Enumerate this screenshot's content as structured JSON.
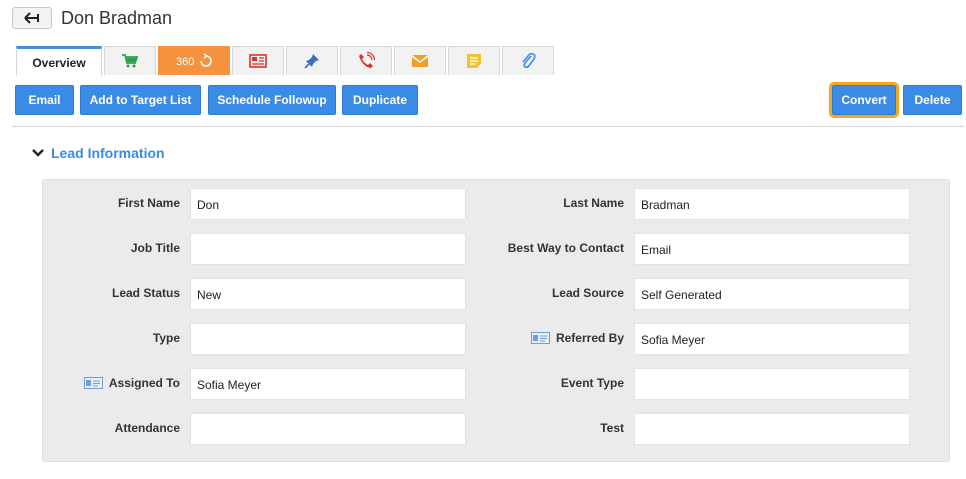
{
  "header": {
    "title": "Don Bradman"
  },
  "tabs": [
    {
      "label": "Overview",
      "icon": "overview"
    },
    {
      "label": "",
      "icon": "cart-icon"
    },
    {
      "label": "360",
      "icon": "360-icon"
    },
    {
      "label": "",
      "icon": "newspaper-icon"
    },
    {
      "label": "",
      "icon": "pin-icon"
    },
    {
      "label": "",
      "icon": "phone-icon"
    },
    {
      "label": "",
      "icon": "mail-icon"
    },
    {
      "label": "",
      "icon": "note-icon"
    },
    {
      "label": "",
      "icon": "paperclip-icon"
    }
  ],
  "actions": {
    "email": "Email",
    "add_to_target_list": "Add to Target List",
    "schedule_followup": "Schedule Followup",
    "duplicate": "Duplicate",
    "convert": "Convert",
    "delete": "Delete"
  },
  "section": {
    "title": "Lead Information"
  },
  "fields": {
    "first_name": {
      "label": "First Name",
      "value": "Don"
    },
    "last_name": {
      "label": "Last Name",
      "value": "Bradman"
    },
    "job_title": {
      "label": "Job Title",
      "value": ""
    },
    "best_way": {
      "label": "Best Way to Contact",
      "value": "Email"
    },
    "lead_status": {
      "label": "Lead Status",
      "value": "New"
    },
    "lead_source": {
      "label": "Lead Source",
      "value": "Self Generated"
    },
    "type": {
      "label": "Type",
      "value": ""
    },
    "referred_by": {
      "label": "Referred By",
      "value": "Sofia Meyer"
    },
    "assigned_to": {
      "label": "Assigned To",
      "value": "Sofia Meyer"
    },
    "event_type": {
      "label": "Event Type",
      "value": ""
    },
    "attendance": {
      "label": "Attendance",
      "value": ""
    },
    "test": {
      "label": "Test",
      "value": ""
    }
  },
  "colors": {
    "accent": "#3a8be6",
    "tab_active_border": "#3f8fe0",
    "tab_360": "#f5923e",
    "highlight": "#f5a623"
  }
}
